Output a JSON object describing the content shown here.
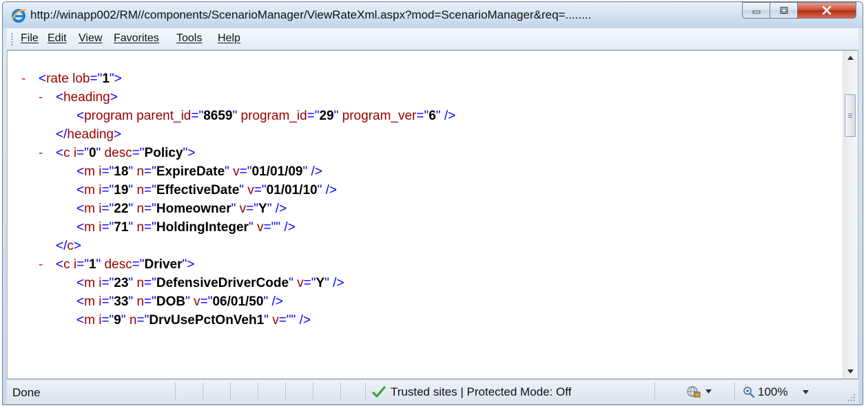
{
  "window": {
    "title_url": "http://winapp002/RM//components/ScenarioManager/ViewRateXml.aspx?mod=ScenarioManager&req=........",
    "icons": {
      "browser": "ie-logo-icon",
      "minimize": "minimize-icon",
      "maximize": "maximize-icon",
      "close": "close-icon"
    },
    "colors": {
      "close": "#c84b34",
      "chrome": "#d5e3f2"
    }
  },
  "menu": {
    "items": [
      "File",
      "Edit",
      "View",
      "Favorites",
      "Tools",
      "Help"
    ]
  },
  "xml": {
    "colors": {
      "tag": "#0000ff",
      "attr": "#990000",
      "value": "#000000",
      "toggle": "#e3122e"
    },
    "lines": [
      {
        "toggle": "-",
        "indent": 0,
        "parts": [
          {
            "c": "b",
            "t": "<"
          },
          {
            "c": "r",
            "t": "rate"
          },
          {
            "c": "r",
            "t": " lob"
          },
          {
            "c": "b",
            "t": "=\""
          },
          {
            "c": "v",
            "t": "1"
          },
          {
            "c": "b",
            "t": "\">"
          }
        ]
      },
      {
        "toggle": "-",
        "indent": 1,
        "parts": [
          {
            "c": "b",
            "t": "<"
          },
          {
            "c": "r",
            "t": "heading"
          },
          {
            "c": "b",
            "t": ">"
          }
        ]
      },
      {
        "toggle": "",
        "indent": 2,
        "parts": [
          {
            "c": "b",
            "t": "<"
          },
          {
            "c": "r",
            "t": "program"
          },
          {
            "c": "r",
            "t": " parent_id"
          },
          {
            "c": "b",
            "t": "=\""
          },
          {
            "c": "v",
            "t": "8659"
          },
          {
            "c": "b",
            "t": "\""
          },
          {
            "c": "r",
            "t": " program_id"
          },
          {
            "c": "b",
            "t": "=\""
          },
          {
            "c": "v",
            "t": "29"
          },
          {
            "c": "b",
            "t": "\""
          },
          {
            "c": "r",
            "t": " program_ver"
          },
          {
            "c": "b",
            "t": "=\""
          },
          {
            "c": "v",
            "t": "6"
          },
          {
            "c": "b",
            "t": "\" />"
          }
        ]
      },
      {
        "toggle": "",
        "indent": 1,
        "parts": [
          {
            "c": "b",
            "t": "</"
          },
          {
            "c": "r",
            "t": "heading"
          },
          {
            "c": "b",
            "t": ">"
          }
        ]
      },
      {
        "toggle": "-",
        "indent": 1,
        "parts": [
          {
            "c": "b",
            "t": "<"
          },
          {
            "c": "r",
            "t": "c"
          },
          {
            "c": "r",
            "t": " i"
          },
          {
            "c": "b",
            "t": "=\""
          },
          {
            "c": "v",
            "t": "0"
          },
          {
            "c": "b",
            "t": "\""
          },
          {
            "c": "r",
            "t": " desc"
          },
          {
            "c": "b",
            "t": "=\""
          },
          {
            "c": "v",
            "t": "Policy"
          },
          {
            "c": "b",
            "t": "\">"
          }
        ]
      },
      {
        "toggle": "",
        "indent": 2,
        "parts": [
          {
            "c": "b",
            "t": "<"
          },
          {
            "c": "r",
            "t": "m"
          },
          {
            "c": "r",
            "t": " i"
          },
          {
            "c": "b",
            "t": "=\""
          },
          {
            "c": "v",
            "t": "18"
          },
          {
            "c": "b",
            "t": "\""
          },
          {
            "c": "r",
            "t": " n"
          },
          {
            "c": "b",
            "t": "=\""
          },
          {
            "c": "v",
            "t": "ExpireDate"
          },
          {
            "c": "b",
            "t": "\""
          },
          {
            "c": "r",
            "t": " v"
          },
          {
            "c": "b",
            "t": "=\""
          },
          {
            "c": "v",
            "t": "01/01/09"
          },
          {
            "c": "b",
            "t": "\" />"
          }
        ]
      },
      {
        "toggle": "",
        "indent": 2,
        "parts": [
          {
            "c": "b",
            "t": "<"
          },
          {
            "c": "r",
            "t": "m"
          },
          {
            "c": "r",
            "t": " i"
          },
          {
            "c": "b",
            "t": "=\""
          },
          {
            "c": "v",
            "t": "19"
          },
          {
            "c": "b",
            "t": "\""
          },
          {
            "c": "r",
            "t": " n"
          },
          {
            "c": "b",
            "t": "=\""
          },
          {
            "c": "v",
            "t": "EffectiveDate"
          },
          {
            "c": "b",
            "t": "\""
          },
          {
            "c": "r",
            "t": " v"
          },
          {
            "c": "b",
            "t": "=\""
          },
          {
            "c": "v",
            "t": "01/01/10"
          },
          {
            "c": "b",
            "t": "\" />"
          }
        ]
      },
      {
        "toggle": "",
        "indent": 2,
        "parts": [
          {
            "c": "b",
            "t": "<"
          },
          {
            "c": "r",
            "t": "m"
          },
          {
            "c": "r",
            "t": " i"
          },
          {
            "c": "b",
            "t": "=\""
          },
          {
            "c": "v",
            "t": "22"
          },
          {
            "c": "b",
            "t": "\""
          },
          {
            "c": "r",
            "t": " n"
          },
          {
            "c": "b",
            "t": "=\""
          },
          {
            "c": "v",
            "t": "Homeowner"
          },
          {
            "c": "b",
            "t": "\""
          },
          {
            "c": "r",
            "t": " v"
          },
          {
            "c": "b",
            "t": "=\""
          },
          {
            "c": "v",
            "t": "Y"
          },
          {
            "c": "b",
            "t": "\" />"
          }
        ]
      },
      {
        "toggle": "",
        "indent": 2,
        "parts": [
          {
            "c": "b",
            "t": "<"
          },
          {
            "c": "r",
            "t": "m"
          },
          {
            "c": "r",
            "t": " i"
          },
          {
            "c": "b",
            "t": "=\""
          },
          {
            "c": "v",
            "t": "71"
          },
          {
            "c": "b",
            "t": "\""
          },
          {
            "c": "r",
            "t": " n"
          },
          {
            "c": "b",
            "t": "=\""
          },
          {
            "c": "v",
            "t": "HoldingInteger"
          },
          {
            "c": "b",
            "t": "\""
          },
          {
            "c": "r",
            "t": " v"
          },
          {
            "c": "b",
            "t": "=\"\" />"
          }
        ]
      },
      {
        "toggle": "",
        "indent": 1,
        "parts": [
          {
            "c": "b",
            "t": "</"
          },
          {
            "c": "r",
            "t": "c"
          },
          {
            "c": "b",
            "t": ">"
          }
        ]
      },
      {
        "toggle": "-",
        "indent": 1,
        "parts": [
          {
            "c": "b",
            "t": "<"
          },
          {
            "c": "r",
            "t": "c"
          },
          {
            "c": "r",
            "t": " i"
          },
          {
            "c": "b",
            "t": "=\""
          },
          {
            "c": "v",
            "t": "1"
          },
          {
            "c": "b",
            "t": "\""
          },
          {
            "c": "r",
            "t": " desc"
          },
          {
            "c": "b",
            "t": "=\""
          },
          {
            "c": "v",
            "t": "Driver"
          },
          {
            "c": "b",
            "t": "\">"
          }
        ]
      },
      {
        "toggle": "",
        "indent": 2,
        "parts": [
          {
            "c": "b",
            "t": "<"
          },
          {
            "c": "r",
            "t": "m"
          },
          {
            "c": "r",
            "t": " i"
          },
          {
            "c": "b",
            "t": "=\""
          },
          {
            "c": "v",
            "t": "23"
          },
          {
            "c": "b",
            "t": "\""
          },
          {
            "c": "r",
            "t": " n"
          },
          {
            "c": "b",
            "t": "=\""
          },
          {
            "c": "v",
            "t": "DefensiveDriverCode"
          },
          {
            "c": "b",
            "t": "\""
          },
          {
            "c": "r",
            "t": " v"
          },
          {
            "c": "b",
            "t": "=\""
          },
          {
            "c": "v",
            "t": "Y"
          },
          {
            "c": "b",
            "t": "\" />"
          }
        ]
      },
      {
        "toggle": "",
        "indent": 2,
        "parts": [
          {
            "c": "b",
            "t": "<"
          },
          {
            "c": "r",
            "t": "m"
          },
          {
            "c": "r",
            "t": " i"
          },
          {
            "c": "b",
            "t": "=\""
          },
          {
            "c": "v",
            "t": "33"
          },
          {
            "c": "b",
            "t": "\""
          },
          {
            "c": "r",
            "t": " n"
          },
          {
            "c": "b",
            "t": "=\""
          },
          {
            "c": "v",
            "t": "DOB"
          },
          {
            "c": "b",
            "t": "\""
          },
          {
            "c": "r",
            "t": " v"
          },
          {
            "c": "b",
            "t": "=\""
          },
          {
            "c": "v",
            "t": "06/01/50"
          },
          {
            "c": "b",
            "t": "\" />"
          }
        ]
      },
      {
        "toggle": "",
        "indent": 2,
        "parts": [
          {
            "c": "b",
            "t": "<"
          },
          {
            "c": "r",
            "t": "m"
          },
          {
            "c": "r",
            "t": " i"
          },
          {
            "c": "b",
            "t": "=\""
          },
          {
            "c": "v",
            "t": "9"
          },
          {
            "c": "b",
            "t": "\""
          },
          {
            "c": "r",
            "t": " n"
          },
          {
            "c": "b",
            "t": "=\""
          },
          {
            "c": "v",
            "t": "DrvUsePctOnVeh1"
          },
          {
            "c": "b",
            "t": "\""
          },
          {
            "c": "r",
            "t": " v"
          },
          {
            "c": "b",
            "t": "=\"\" />"
          }
        ]
      }
    ]
  },
  "scrollbar": {
    "icons": {
      "up": "scroll-up-arrow-icon",
      "down": "scroll-down-arrow-icon",
      "grip": "scroll-thumb-grip-icon"
    }
  },
  "status": {
    "text": "Done",
    "zone": "Trusted sites | Protected Mode: Off",
    "zoom": "100%",
    "icons": {
      "zone": "checkmark-icon",
      "security": "globe-lock-icon",
      "zoom": "magnifier-icon",
      "dropdown": "chevron-down-icon"
    }
  }
}
